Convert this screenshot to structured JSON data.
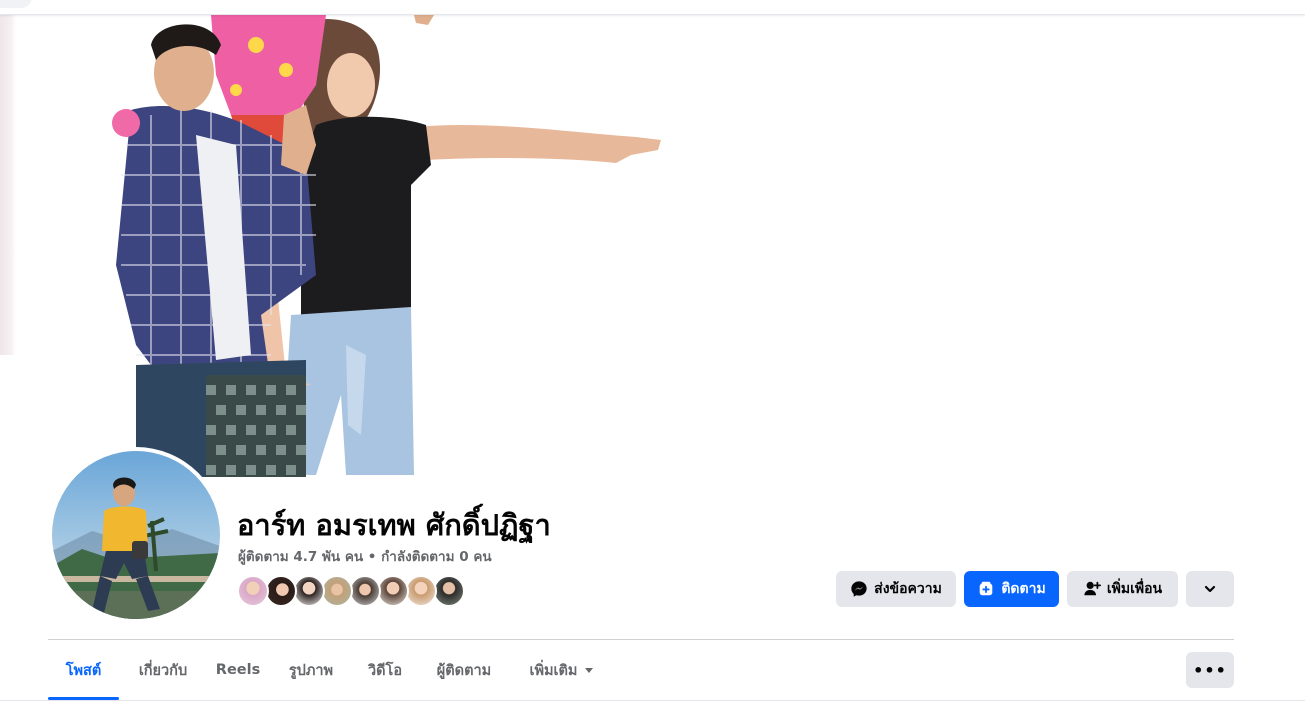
{
  "profile": {
    "name": "อาร์ท อมรเทพ ศักดิ์ปฏิฐา",
    "followers_text": "ผู้ติดตาม 4.7 พัน คน",
    "separator": " • ",
    "following_text": "กำลังติดตาม 0 คน"
  },
  "friends_count_shown": 8,
  "actions": {
    "message_label": "ส่งข้อความ",
    "follow_label": "ติดตาม",
    "add_friend_label": "เพิ่มเพื่อน"
  },
  "tabs": [
    {
      "label": "โพสต์",
      "active": true
    },
    {
      "label": "เกี่ยวกับ",
      "active": false
    },
    {
      "label": "Reels",
      "active": false
    },
    {
      "label": "รูปภาพ",
      "active": false
    },
    {
      "label": "วิดีโอ",
      "active": false
    },
    {
      "label": "ผู้ติดตาม",
      "active": false
    },
    {
      "label": "เพิ่มเติม",
      "active": false
    }
  ],
  "more_menu_glyph": "•••",
  "colors": {
    "accent": "#0866ff",
    "secondary_button": "#e4e6eb",
    "muted_text": "#65676b"
  },
  "icons": [
    "messenger-icon",
    "follow-icon",
    "add-friend-icon",
    "chevron-down-icon",
    "more-icon"
  ]
}
